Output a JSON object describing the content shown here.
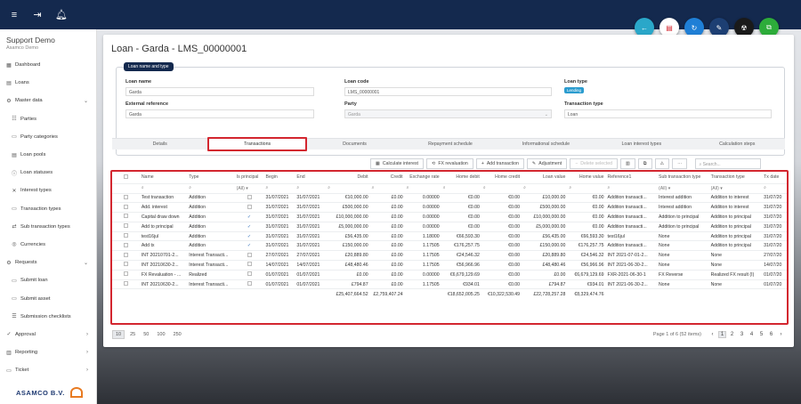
{
  "topbar": {
    "menu_icon": "menu-icon",
    "logout_icon": "logout-icon",
    "bell_icon": "bell-icon"
  },
  "brand": {
    "title": "Support Demo",
    "subtitle": "Asamco Demo"
  },
  "nav": [
    {
      "label": "Dashboard",
      "icon": "dashboard-icon",
      "sub": false,
      "chev": ""
    },
    {
      "label": "Loans",
      "icon": "loans-icon",
      "sub": false,
      "chev": ""
    },
    {
      "label": "Master data",
      "icon": "master-data-icon",
      "sub": false,
      "chev": "⌄"
    },
    {
      "label": "Parties",
      "icon": "parties-icon",
      "sub": true,
      "chev": ""
    },
    {
      "label": "Party categories",
      "icon": "party-categories-icon",
      "sub": true,
      "chev": ""
    },
    {
      "label": "Loan pools",
      "icon": "loan-pools-icon",
      "sub": true,
      "chev": ""
    },
    {
      "label": "Loan statuses",
      "icon": "loan-statuses-icon",
      "sub": true,
      "chev": ""
    },
    {
      "label": "Interest types",
      "icon": "interest-types-icon",
      "sub": true,
      "chev": ""
    },
    {
      "label": "Transaction types",
      "icon": "transaction-types-icon",
      "sub": true,
      "chev": ""
    },
    {
      "label": "Sub transaction types",
      "icon": "sub-transaction-types-icon",
      "sub": true,
      "chev": ""
    },
    {
      "label": "Currencies",
      "icon": "currencies-icon",
      "sub": true,
      "chev": ""
    },
    {
      "label": "Requests",
      "icon": "requests-icon",
      "sub": false,
      "chev": "⌄"
    },
    {
      "label": "Submit loan",
      "icon": "submit-loan-icon",
      "sub": true,
      "chev": ""
    },
    {
      "label": "Submit asset",
      "icon": "submit-asset-icon",
      "sub": true,
      "chev": ""
    },
    {
      "label": "Submission checklists",
      "icon": "submission-checklists-icon",
      "sub": true,
      "chev": ""
    },
    {
      "label": "Approval",
      "icon": "approval-icon",
      "sub": false,
      "chev": "›"
    },
    {
      "label": "Reporting",
      "icon": "reporting-icon",
      "sub": false,
      "chev": "›"
    },
    {
      "label": "Ticket",
      "icon": "ticket-icon",
      "sub": false,
      "chev": "›"
    }
  ],
  "logo_text": "ASAMCO B.V.",
  "fabs": [
    {
      "name": "back-icon",
      "color": "#2aa7c9",
      "glyph": "←"
    },
    {
      "name": "pdf-icon",
      "color": "#ffffff",
      "glyph": "▤"
    },
    {
      "name": "refresh-icon",
      "color": "#1f7fd6",
      "glyph": "↻"
    },
    {
      "name": "edit-icon",
      "color": "#1d3f73",
      "glyph": "✎"
    },
    {
      "name": "radiation-icon",
      "color": "#1a1a1a",
      "glyph": "☢"
    },
    {
      "name": "copy-icon",
      "color": "#2dac3a",
      "glyph": "⧉"
    }
  ],
  "page_title": "Loan - Garda - LMS_00000001",
  "section_legend": "Loan name and type",
  "fields": {
    "loan_name_label": "Loan name",
    "loan_name": "Garda",
    "loan_code_label": "Loan code",
    "loan_code": "LMS_00000001",
    "loan_type_label": "Loan type",
    "loan_type": "Lending",
    "external_ref_label": "External reference",
    "external_ref": "Garda",
    "party_label": "Party",
    "party": "Garda",
    "transaction_type_label": "Transaction type",
    "transaction_type": "Loan"
  },
  "tabs": [
    "Details",
    "Transactions",
    "Documents",
    "Repayment schedule",
    "Informational schedule",
    "Loan interest types",
    "Calculation steps"
  ],
  "active_tab": 1,
  "toolbar": {
    "calculate": "Calculate interest",
    "fx": "FX revaluation",
    "add": "Add transaction",
    "adjustment": "Adjustment",
    "delete": "Delete selected",
    "search_placeholder": "Search..."
  },
  "columns": [
    "",
    "Name",
    "Type",
    "Is principal",
    "Begin",
    "End",
    "Debit",
    "Credit",
    "Exchange rate",
    "Home debit",
    "Home credit",
    "Loan value",
    "Home value",
    "Reference1",
    "Sub transaction type",
    "Transaction type",
    "Tx date"
  ],
  "filter_all": "(All)",
  "rows": [
    [
      "Test transaction",
      "Addition",
      "",
      "31/07/2021",
      "31/07/2021",
      "€10,000.00",
      "£0.00",
      "0.00000",
      "€0.00",
      "€0.00",
      "£10,000.00",
      "€0.00",
      "Addition transacti...",
      "Interest addition",
      "Addition to interest",
      "31/07/20"
    ],
    [
      "Add. interest",
      "Addition",
      "",
      "31/07/2021",
      "31/07/2021",
      "£500,000.00",
      "£0.00",
      "0.00000",
      "€0.00",
      "€0.00",
      "£500,000.00",
      "€0.00",
      "Addition transacti...",
      "Interest addition",
      "Addition to interest",
      "31/07/20"
    ],
    [
      "Capital draw down",
      "Addition",
      "✓",
      "31/07/2021",
      "31/07/2021",
      "£10,000,000.00",
      "£0.00",
      "0.00000",
      "€0.00",
      "€0.00",
      "£10,000,000.00",
      "€0.00",
      "Addition transacti...",
      "Addition to principal",
      "Addition to principal",
      "31/07/20"
    ],
    [
      "Add to principal",
      "Addition",
      "✓",
      "31/07/2021",
      "31/07/2021",
      "£5,000,000.00",
      "£0.00",
      "0.00000",
      "€0.00",
      "€0.00",
      "£5,000,000.00",
      "€0.00",
      "Addition transacti...",
      "Addition to principal",
      "Addition to principal",
      "31/07/20"
    ],
    [
      "test16jul",
      "Addition",
      "✓",
      "31/07/2021",
      "31/07/2021",
      "£56,435.00",
      "£0.00",
      "1.18000",
      "€66,593.30",
      "€0.00",
      "£56,435.00",
      "€66,593.30",
      "test16jul",
      "None",
      "Addition to principal",
      "31/07/20"
    ],
    [
      "Add tx",
      "Addition",
      "✓",
      "31/07/2021",
      "31/07/2021",
      "£150,000.00",
      "£0.00",
      "1.17505",
      "€176,257.75",
      "€0.00",
      "£150,000.00",
      "€176,257.75",
      "Addition transacti...",
      "None",
      "Addition to principal",
      "31/07/20"
    ],
    [
      "INT 20210701-2...",
      "Interest Transacti...",
      "",
      "27/07/2021",
      "27/07/2021",
      "£20,889.80",
      "£0.00",
      "1.17505",
      "€24,546.32",
      "€0.00",
      "£20,889.80",
      "€24,546.32",
      "INT 2021-07-01-2...",
      "None",
      "None",
      "27/07/20"
    ],
    [
      "INT 20210630-2...",
      "Interest Transacti...",
      "",
      "14/07/2021",
      "14/07/2021",
      "£48,480.46",
      "£0.00",
      "1.17505",
      "€56,966.96",
      "€0.00",
      "£48,480.46",
      "€56,966.96",
      "INT 2021-06-30-2...",
      "None",
      "None",
      "14/07/20"
    ],
    [
      "FX Revaluation - ...",
      "Realized",
      "",
      "01/07/2021",
      "01/07/2021",
      "£0.00",
      "£0.00",
      "0.00000",
      "€6,679,129.69",
      "€0.00",
      "£0.00",
      "€6,679,129.69",
      "FXR-2021-06-30-1",
      "FX Reverse",
      "Realized FX result (I)",
      "01/07/20"
    ],
    [
      "INT 20210630-2...",
      "Interest Transacti...",
      "",
      "01/07/2021",
      "01/07/2021",
      "£794.87",
      "£0.00",
      "1.17505",
      "€934.01",
      "€0.00",
      "£794.87",
      "€934.01",
      "INT 2021-06-30-2...",
      "None",
      "None",
      "01/07/20"
    ]
  ],
  "totals": [
    "£25,407,664.52",
    "£2,759,407.24",
    "",
    "€18,652,005.25",
    "€10,322,530.49",
    "£22,728,257.28",
    "€8,329,474.76"
  ],
  "pager": {
    "sizes": [
      "10",
      "25",
      "50",
      "100",
      "250"
    ],
    "info": "Page 1 of 6 (52 items)",
    "pages": [
      "1",
      "2",
      "3",
      "4",
      "5",
      "6"
    ]
  }
}
